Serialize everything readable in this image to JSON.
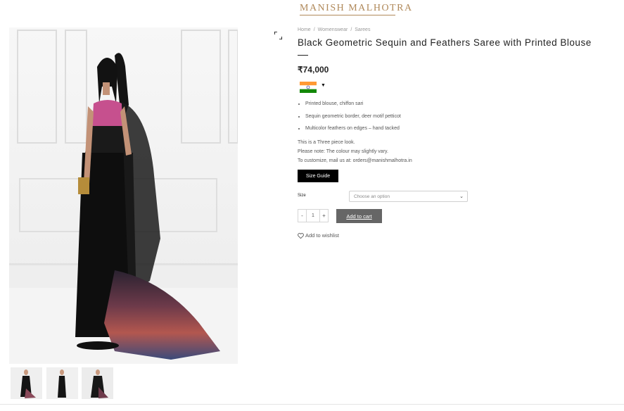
{
  "header": {
    "logo_text": "MANISH MALHOTRA"
  },
  "breadcrumb": {
    "items": [
      "Home",
      "Womenswear",
      "Sarees"
    ],
    "separator": "/"
  },
  "product": {
    "title": "Black Geometric Sequin and Feathers Saree with Printed Blouse",
    "price": "₹74,000",
    "features": [
      "Printed blouse, chiffon sari",
      "Sequin geometric border, deer motif petticot",
      "Multicolor feathers on edges – hand tacked"
    ],
    "description_lines": [
      "This is a Three piece look.",
      "Please note: The colour may slightly vary.",
      "To customize, mail us at: orders@manishmalhotra.in"
    ]
  },
  "currency_selector": {
    "flag_icon": "india-flag-icon",
    "arrow": "▼"
  },
  "size_guide": {
    "label": "Size Guide"
  },
  "size": {
    "label": "Size",
    "placeholder": "Choose an option"
  },
  "quantity": {
    "minus": "-",
    "value": "1",
    "plus": "+"
  },
  "cart": {
    "add_label": "Add to cart"
  },
  "wishlist": {
    "label": "Add to wishlist",
    "icon": "heart-icon"
  },
  "colors": {
    "logo": "#b0895a",
    "button_dark": "#000000",
    "button_cart": "#666666"
  }
}
